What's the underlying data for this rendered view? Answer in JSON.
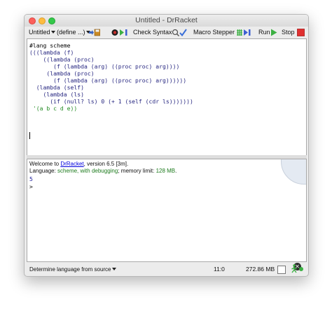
{
  "window": {
    "title": "Untitled - DrRacket"
  },
  "toolbar": {
    "file_menu": "Untitled",
    "define_menu": "(define ...)",
    "check_syntax": "Check Syntax",
    "macro_stepper": "Macro Stepper",
    "run": "Run",
    "stop": "Stop"
  },
  "editor": {
    "lines": [
      "#lang scheme",
      "(((lambda (f)",
      "    ((lambda (proc)",
      "       (f (lambda (arg) ((proc proc) arg))))",
      "     (lambda (proc)",
      "       (f (lambda (arg) ((proc proc) arg))))))",
      "  (lambda (self)",
      "    (lambda (ls)",
      "      (if (null? ls) 0 (+ 1 (self (cdr ls)))))))",
      " '(a b c d e))"
    ]
  },
  "interactions": {
    "welcome_prefix": "Welcome to ",
    "welcome_link": "DrRacket",
    "welcome_suffix": ", version 6.5 [3m].",
    "language_prefix": "Language: ",
    "language_name": "scheme, with debugging",
    "memory_prefix": "; memory limit: ",
    "memory_limit": "128 MB",
    "memory_suffix": ".",
    "result": "5",
    "prompt": ">"
  },
  "status": {
    "language_selector": "Determine language from source",
    "position": "11:0",
    "memory": "272.86 MB"
  },
  "colors": {
    "stop_red": "#e03030",
    "run_green": "#3cb043",
    "link_blue": "#0000dd",
    "code_blue": "#262680",
    "language_green": "#1c7a1c"
  }
}
